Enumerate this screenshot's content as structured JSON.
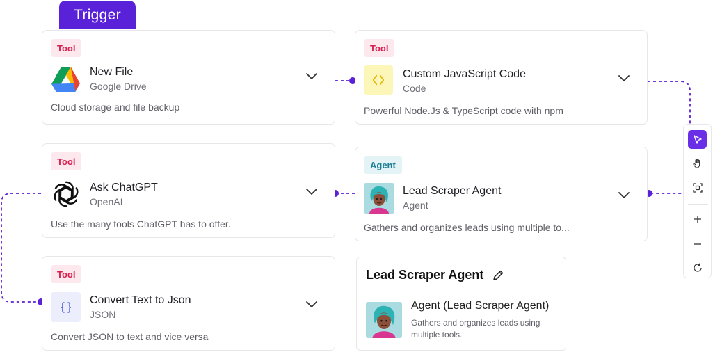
{
  "trigger_tab": "Trigger",
  "cards": [
    {
      "badge": "Tool",
      "title": "New File",
      "subtitle": "Google Drive",
      "description": "Cloud storage and file backup",
      "icon": "google-drive-icon"
    },
    {
      "badge": "Tool",
      "title": "Custom JavaScript Code",
      "subtitle": "Code",
      "description": "Powerful Node.Js & TypeScript code with npm",
      "icon": "code-brackets-icon"
    },
    {
      "badge": "Tool",
      "title": "Ask ChatGPT",
      "subtitle": "OpenAI",
      "description": "Use the many tools ChatGPT has to offer.",
      "icon": "openai-icon"
    },
    {
      "badge": "Agent",
      "title": "Lead Scraper Agent",
      "subtitle": "Agent",
      "description": "Gathers and organizes leads using multiple to...",
      "icon": "agent-avatar-icon"
    },
    {
      "badge": "Tool",
      "title": "Convert Text to Json",
      "subtitle": "JSON",
      "description": "Convert JSON to text and vice versa",
      "icon": "json-braces-icon"
    }
  ],
  "detail_panel": {
    "title": "Lead Scraper Agent",
    "agent_name": "Agent (Lead Scraper Agent)",
    "agent_description": "Gathers and organizes leads using multiple tools."
  },
  "toolbar": {
    "tools": [
      "pointer-icon",
      "hand-icon",
      "fit-view-icon",
      "zoom-in-icon",
      "zoom-out-icon",
      "reset-icon"
    ],
    "active": "pointer-icon"
  },
  "colors": {
    "accent": "#5a22d8",
    "tool_badge_bg": "#fde8ee",
    "tool_badge_text": "#d61f4f",
    "agent_badge_bg": "#e3f3f6",
    "agent_badge_text": "#1c7f95",
    "connector": "#5b21d6"
  }
}
